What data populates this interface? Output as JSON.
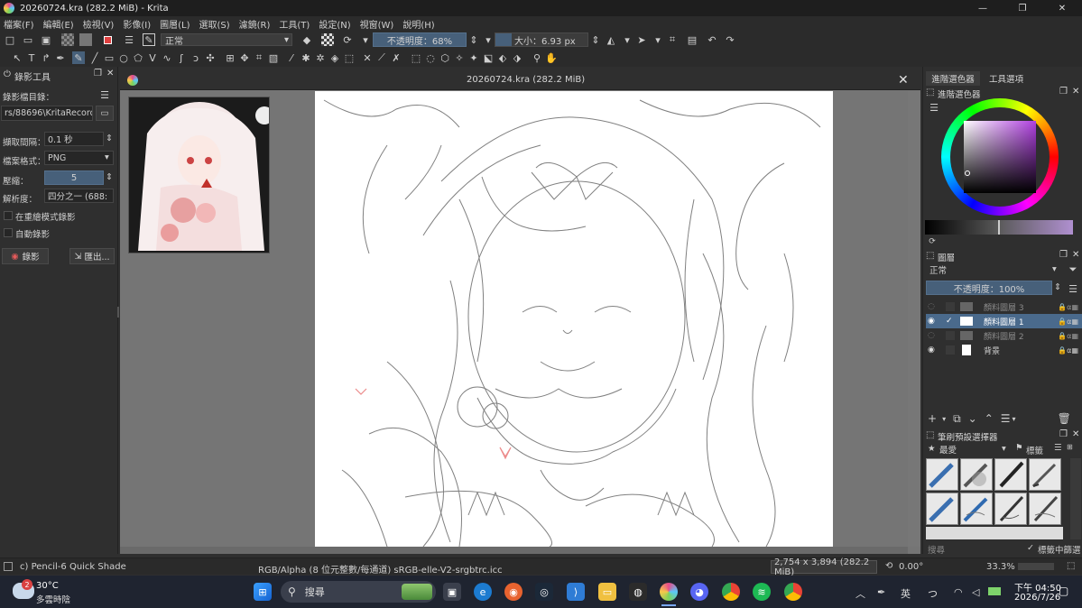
{
  "window": {
    "title": "20260724.kra (282.2 MiB)  - Krita",
    "minimize": "—",
    "maximize": "❐",
    "close": "✕"
  },
  "menu": [
    "檔案(F)",
    "編輯(E)",
    "檢視(V)",
    "影像(I)",
    "圖層(L)",
    "選取(S)",
    "濾鏡(R)",
    "工具(T)",
    "設定(N)",
    "視窗(W)",
    "說明(H)"
  ],
  "toolbar": {
    "blend_mode": "正常",
    "opacity_label": "不透明度：68%",
    "size_label": "大小：6.93 px"
  },
  "recorder": {
    "title": "錄影工具",
    "dir_label": "錄影檔目錄：",
    "dir_value": "rs/88696\\KritaRecorder",
    "interval_label": "擷取間隔：",
    "interval_value": "0.1 秒",
    "format_label": "檔案格式：",
    "format_value": "PNG",
    "quality_label": "壓縮：",
    "quality_value": "5",
    "resolution_label": "解析度：",
    "resolution_value": "四分之一 (688:",
    "checkbox1": "在重繪模式錄影",
    "checkbox2": "自動錄影",
    "record_button": "錄影",
    "export_button": "匯出..."
  },
  "document": {
    "tab_title": "20260724.kra (282.2 MiB)"
  },
  "right": {
    "tab1": "進階選色器",
    "tab2": "工具選項",
    "color_title": "進階選色器",
    "layers_title": "圖層",
    "layers_blend": "正常",
    "layers_opacity": "不透明度：100%",
    "layers": [
      {
        "name": "顏料圖層 3",
        "visible": false,
        "active": false
      },
      {
        "name": "顏料圖層 1",
        "visible": true,
        "active": true
      },
      {
        "name": "顏料圖層 2",
        "visible": false,
        "active": false
      },
      {
        "name": "背景",
        "visible": true,
        "active": false
      }
    ],
    "brushes_title": "筆刷預設選擇器",
    "brushes_filter": "最愛",
    "brushes_tag_label": "標籤",
    "brushes_search_placeholder": "搜尋",
    "brushes_search_in_tag": "標籤中篩選"
  },
  "status": {
    "brush": "c) Pencil-6 Quick Shade",
    "color_space": "RGB/Alpha (8 位元整數/每通道)  sRGB-elle-V2-srgbtrc.icc",
    "dimensions": "2,754 x 3,894 (282.2 MiB)",
    "rotation": "0.00°",
    "zoom": "33.3%"
  },
  "taskbar": {
    "weather_temp": "30°C",
    "weather_desc": "多雲時陰",
    "weather_badge": "2",
    "search": "搜尋",
    "ime": "英",
    "time": "下午 04:50",
    "date": "2026/7/26"
  },
  "colors": {
    "accent_blue": "#47607a",
    "layer_active": "#4a6a8c",
    "brush_red": "#e45a5a"
  }
}
